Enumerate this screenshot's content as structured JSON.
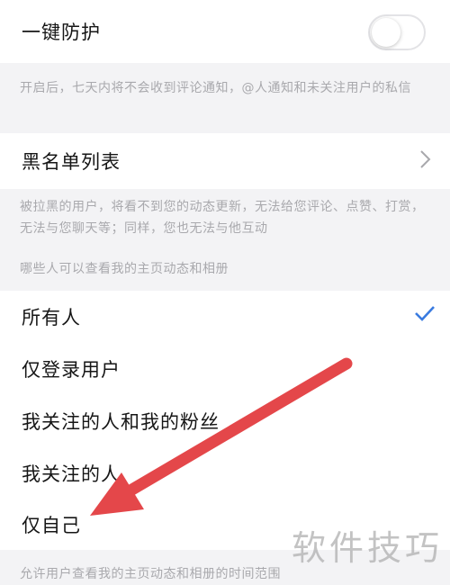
{
  "one_key_protection": {
    "label": "一键防护",
    "enabled": false,
    "note": "开启后，七天内将不会收到评论通知，@人通知和未关注用户的私信"
  },
  "blacklist": {
    "label": "黑名单列表",
    "note": "被拉黑的用户，将看不到您的动态更新，无法给您评论、点赞、打赏，无法与您聊天等；同样，您也无法与他互动"
  },
  "visibility": {
    "section_title": "哪些人可以查看我的主页动态和相册",
    "selected_index": 0,
    "options": [
      {
        "label": "所有人"
      },
      {
        "label": "仅登录用户"
      },
      {
        "label": "我关注的人和我的粉丝"
      },
      {
        "label": "我关注的人"
      },
      {
        "label": "仅自己"
      }
    ],
    "footer_note": "允许用户查看我的主页动态和相册的时间范围"
  },
  "watermark": "软件技巧",
  "colors": {
    "accent": "#3a7be0",
    "arrow": "#e4474a"
  }
}
